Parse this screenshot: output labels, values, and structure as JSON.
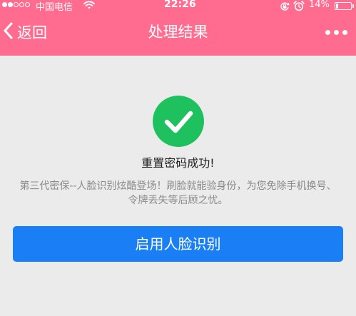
{
  "status_bar": {
    "carrier": "中国电信",
    "time": "22:26",
    "battery_percent": "14%",
    "battery_level": 0.14,
    "signal_strength": 2,
    "icons": [
      "wifi-icon",
      "rotation-lock-icon",
      "alarm-icon",
      "battery-icon"
    ]
  },
  "nav": {
    "back_label": "返回",
    "title": "处理结果",
    "back_icon": "chevron-left-icon",
    "more_icon": "more-icon"
  },
  "result": {
    "icon": "check-circle-icon",
    "title": "重置密码成功!",
    "description": "第三代密保--人脸识别炫酷登场！刷脸就能验身份，为您免除手机换号、令牌丢失等后顾之忧。"
  },
  "primary_button": {
    "label": "启用人脸识别"
  },
  "colors": {
    "header": "#ff6c8f",
    "background": "#ebebeb",
    "success": "#1ec15d",
    "primary_button": "#1a7ff5",
    "description_text": "#8a8a8a"
  }
}
